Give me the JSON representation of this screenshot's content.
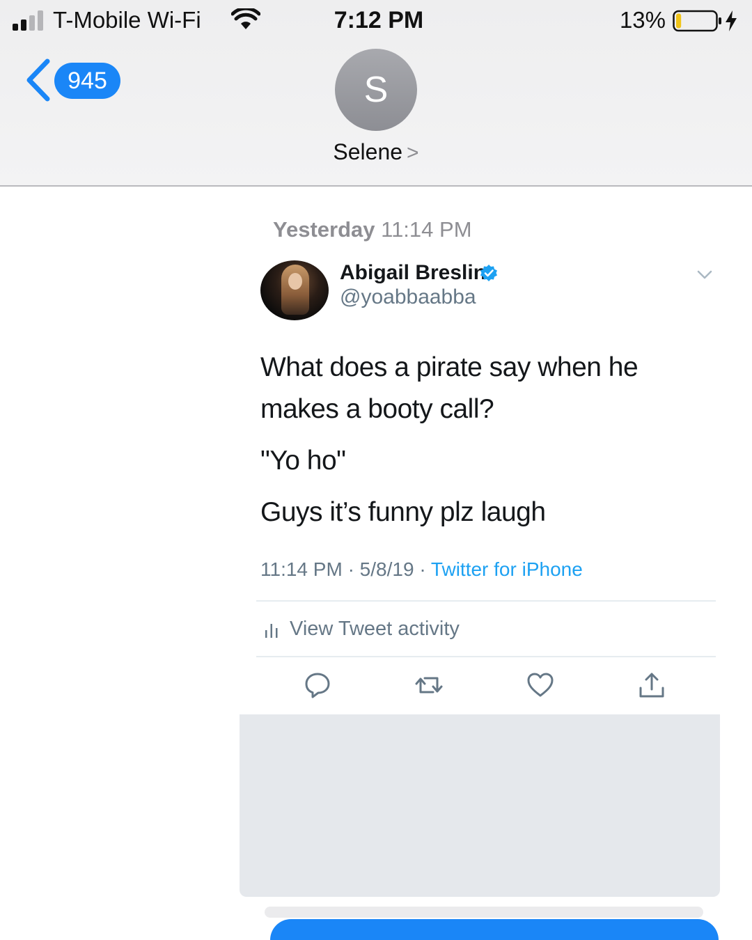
{
  "status_bar": {
    "carrier": "T-Mobile Wi-Fi",
    "time": "7:12 PM",
    "battery_percent": "13%",
    "battery_level": 0.13,
    "signal_bars": 2,
    "charging": true
  },
  "nav": {
    "back_count": "945",
    "contact_initial": "S",
    "contact_name": "Selene",
    "contact_chevron": ">"
  },
  "conversation": {
    "timestamp_day": "Yesterday",
    "timestamp_time": "11:14 PM"
  },
  "tweet": {
    "author_name": "Abigail Breslin",
    "author_handle": "@yoabbaabba",
    "verified": true,
    "text_lines": [
      "What does a pirate say when he",
      "makes a booty call?",
      "\"Yo ho\"",
      "Guys it’s funny plz laugh"
    ],
    "time": "11:14 PM",
    "date": "5/8/19",
    "separator": "·",
    "source": "Twitter for iPhone",
    "activity_label": "View Tweet activity",
    "actions": [
      "reply-icon",
      "retweet-icon",
      "like-icon",
      "share-icon"
    ]
  },
  "colors": {
    "imessage_blue": "#1a86f7",
    "twitter_blue": "#1da1f2",
    "muted_gray": "#657786",
    "header_gray": "#eeeeef"
  }
}
